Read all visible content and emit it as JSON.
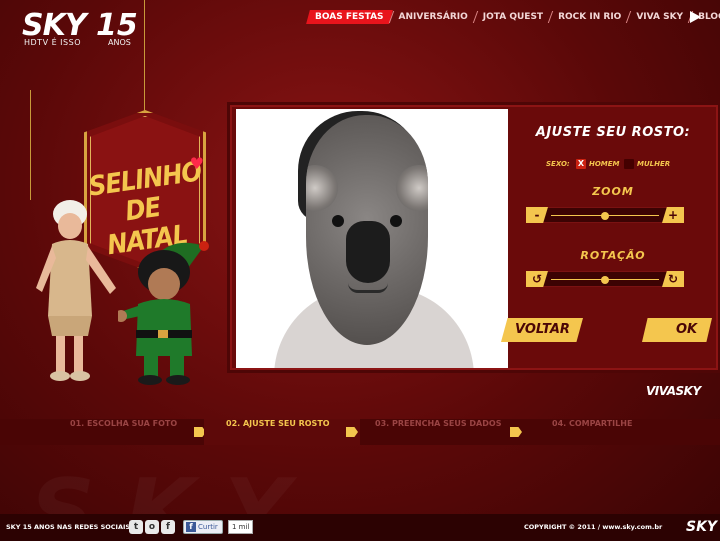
{
  "brand": {
    "logo_text": "SKY",
    "logo_number": "15",
    "tagline": "HDTV É ISSO",
    "anos": "ANOS",
    "vivasky": "VIVASKY",
    "footer_logo": "SKY"
  },
  "topnav": {
    "items": [
      {
        "label": "BOAS FESTAS",
        "active": true
      },
      {
        "label": "ANIVERSÁRIO",
        "active": false
      },
      {
        "label": "JOTA QUEST",
        "active": false
      },
      {
        "label": "ROCK IN RIO",
        "active": false
      },
      {
        "label": "VIVA SKY",
        "active": false
      },
      {
        "label": "BLOG",
        "active": false
      }
    ]
  },
  "sign": {
    "line1": "SELINHO",
    "line2": "DE NATAL"
  },
  "editor": {
    "title": "AJUSTE SEU ROSTO:",
    "sexo_label": "SEXO:",
    "options": [
      {
        "label": "HOMEM",
        "checked": true,
        "mark": "X"
      },
      {
        "label": "MULHER",
        "checked": false,
        "mark": ""
      }
    ],
    "zoom_label": "ZOOM",
    "zoom_minus": "-",
    "zoom_plus": "+",
    "zoom_level": 0.5,
    "rotacao_label": "ROTAÇÃO",
    "rotate_left": "↺",
    "rotate_right": "↻",
    "rotation_level": 0.5,
    "back_button": "VOLTAR",
    "ok_button": "OK"
  },
  "steps": [
    {
      "label": "01. ESCOLHA SUA FOTO",
      "active": false
    },
    {
      "label": "02. AJUSTE SEU ROSTO",
      "active": true
    },
    {
      "label": "03. PREENCHA SEUS DADOS",
      "active": false
    },
    {
      "label": "04. COMPARTILHE",
      "active": false
    }
  ],
  "footer": {
    "social_label": "SKY 15 ANOS NAS REDES SOCIAIS:",
    "social_icons": [
      "t",
      "o",
      "f"
    ],
    "like_label": "Curtir",
    "like_icon": "f",
    "like_count": "1 mil",
    "copyright": "COPYRIGHT © 2011   /   www.sky.com.br"
  },
  "colors": {
    "accent_yellow": "#f4c64e",
    "brand_red": "#e8141c",
    "panel_dark": "#6a0a0a"
  }
}
